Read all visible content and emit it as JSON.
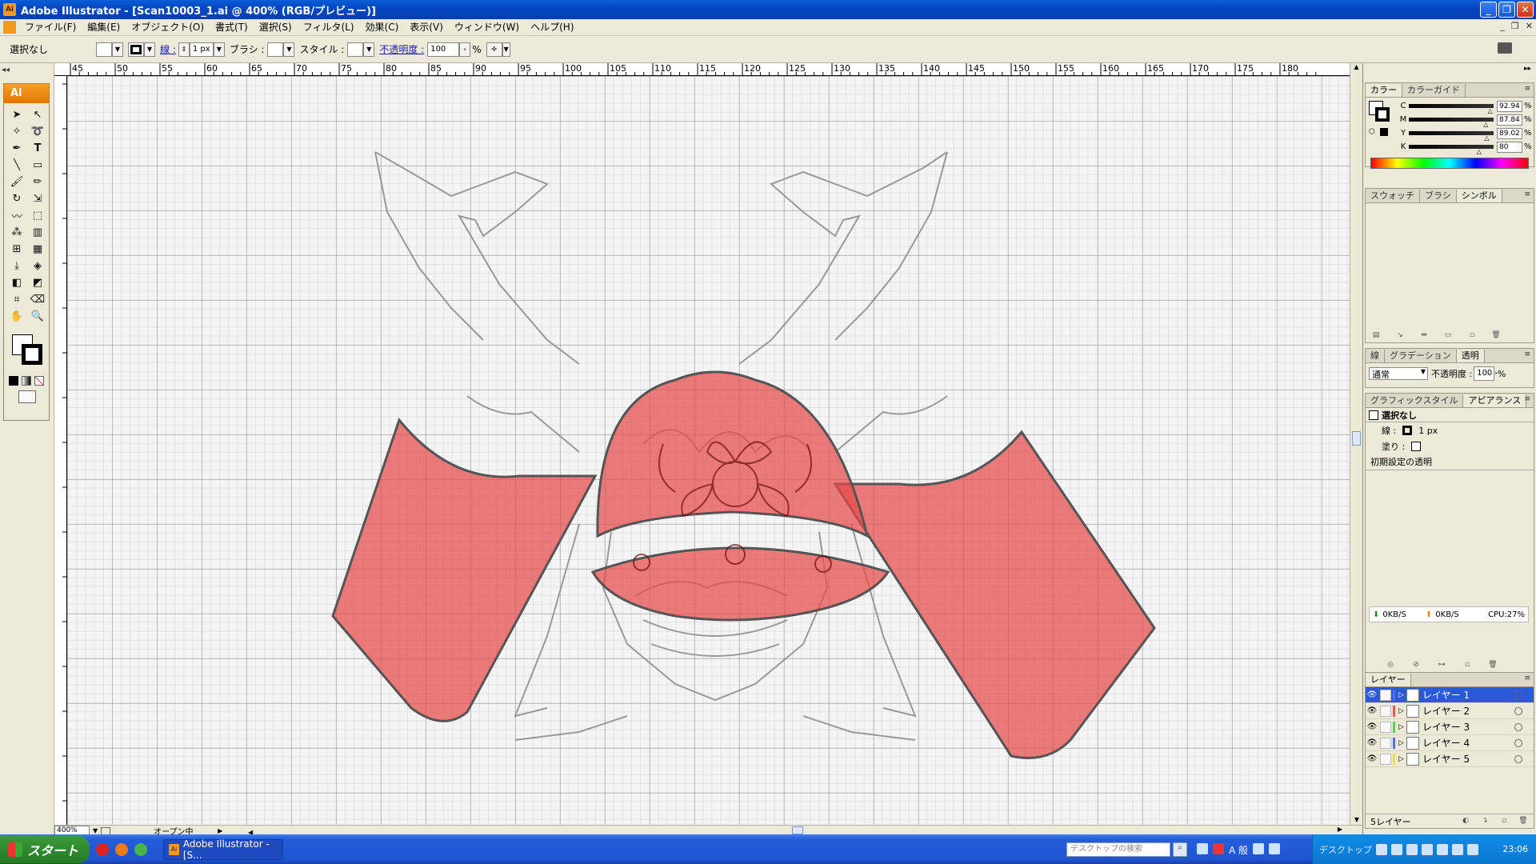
{
  "window": {
    "title": "Adobe Illustrator - [Scan10003_1.ai @ 400% (RGB/プレビュー)]"
  },
  "menu": [
    "ファイル(F)",
    "編集(E)",
    "オブジェクト(O)",
    "書式(T)",
    "選択(S)",
    "フィルタ(L)",
    "効果(C)",
    "表示(V)",
    "ウィンドウ(W)",
    "ヘルプ(H)"
  ],
  "control": {
    "selection": "選択なし",
    "stroke_label": "線 :",
    "stroke_weight": "1 px",
    "brush_label": "ブラシ :",
    "style_label": "スタイル :",
    "opacity_label": "不透明度 :",
    "opacity_value": "100",
    "percent": "%"
  },
  "ruler": {
    "top_ticks": [
      "45",
      "50",
      "55",
      "60",
      "65",
      "70",
      "75",
      "80",
      "85",
      "90",
      "95",
      "100",
      "105",
      "110",
      "115",
      "120",
      "125",
      "130",
      "135",
      "140",
      "145",
      "150",
      "155",
      "160",
      "165",
      "170",
      "175",
      "180"
    ]
  },
  "toolbox": {
    "header": "Ai"
  },
  "status": {
    "zoom": "400%",
    "state": "オープン中"
  },
  "color_panel": {
    "tabs": [
      "カラー",
      "カラーガイド"
    ],
    "channels": [
      {
        "name": "C",
        "value": "92.94",
        "level": 0.93
      },
      {
        "name": "M",
        "value": "87.84",
        "level": 0.88
      },
      {
        "name": "Y",
        "value": "89.02",
        "level": 0.89
      },
      {
        "name": "K",
        "value": "80",
        "level": 0.8
      }
    ],
    "unit": "%"
  },
  "swatch_panel": {
    "tabs": [
      "スウォッチ",
      "ブラシ",
      "シンボル"
    ]
  },
  "transparency_panel": {
    "tabs": [
      "線",
      "グラデーション",
      "透明"
    ],
    "mode": "通常",
    "opacity_label": "不透明度 :",
    "opacity_value": "100"
  },
  "appearance_panel": {
    "tabs": [
      "グラフィックスタイル",
      "アピアランス"
    ],
    "title": "選択なし",
    "stroke_label": "線 :",
    "stroke_value": "1 px",
    "fill_label": "塗り :",
    "default_transparency": "初期設定の透明"
  },
  "net_meter": {
    "down": "0KB/S",
    "up": "0KB/S",
    "cpu": "CPU:27%"
  },
  "layers_panel": {
    "tab": "レイヤー",
    "layers": [
      {
        "name": "レイヤー 1",
        "color": "#4f6cff",
        "selected": true
      },
      {
        "name": "レイヤー 2",
        "color": "#ff4f4f",
        "selected": false
      },
      {
        "name": "レイヤー 3",
        "color": "#4fd84f",
        "selected": false
      },
      {
        "name": "レイヤー 4",
        "color": "#4f6cff",
        "selected": false
      },
      {
        "name": "レイヤー 5",
        "color": "#f0e040",
        "selected": false
      }
    ],
    "footer": "5レイヤー"
  },
  "taskbar": {
    "start": "スタート",
    "app": "Adobe Illustrator - [S...",
    "search_placeholder": "デスクトップの検索",
    "ime": "A 般",
    "desktop": "デスクトップ",
    "clock": "23:06"
  },
  "colors": {
    "accent": "#2a5ad8",
    "art_red": "#e84a4a"
  }
}
